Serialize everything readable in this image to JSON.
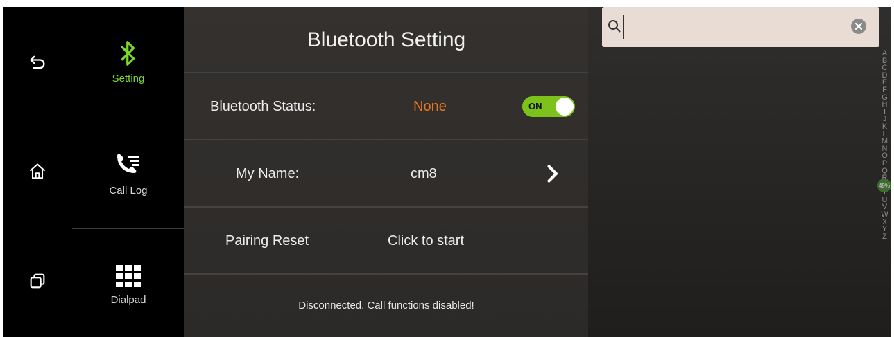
{
  "nav": {
    "system": [
      {
        "name": "back-icon"
      },
      {
        "name": "home-icon"
      },
      {
        "name": "recent-apps-icon"
      }
    ],
    "tabs": [
      {
        "label": "Setting",
        "icon": "bluetooth-icon",
        "active": true
      },
      {
        "label": "Call Log",
        "icon": "call-log-icon",
        "active": false
      },
      {
        "label": "Dialpad",
        "icon": "dialpad-icon",
        "active": false
      }
    ]
  },
  "panel": {
    "title": "Bluetooth Setting",
    "status": {
      "label": "Bluetooth Status:",
      "value": "None",
      "value_color": "#e8761e",
      "toggle": "ON"
    },
    "name": {
      "label": "My Name:",
      "value": "cm8"
    },
    "pairing": {
      "label": "Pairing Reset",
      "value": "Click to start"
    },
    "message": "Disconnected. Call functions disabled!"
  },
  "contacts": {
    "search": {
      "value": "",
      "placeholder": ""
    },
    "alphabet": [
      "A",
      "B",
      "C",
      "D",
      "E",
      "F",
      "G",
      "H",
      "I",
      "J",
      "K",
      "L",
      "M",
      "N",
      "O",
      "P",
      "Q",
      "R",
      "S",
      "T",
      "U",
      "V",
      "W",
      "X",
      "Y",
      "Z"
    ],
    "scroll_badge": "49%"
  },
  "colors": {
    "accent": "#7cd82d",
    "toggle_on": "#7cc21b"
  }
}
